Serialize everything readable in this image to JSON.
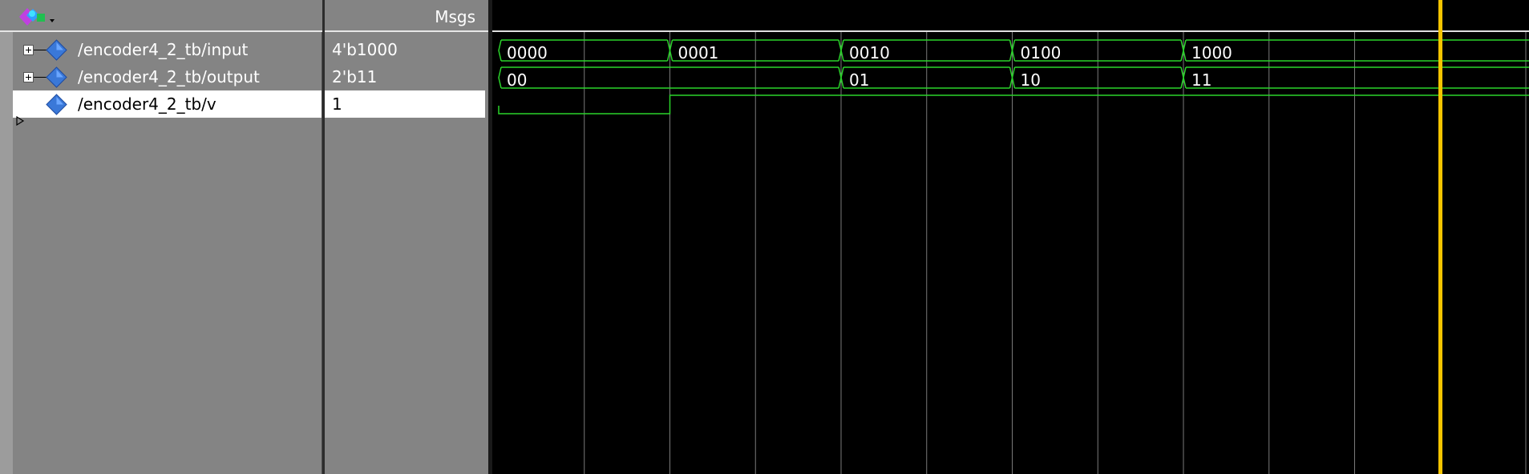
{
  "names_pane": {
    "header_menu_icon": "wave-toolbar-icon",
    "rows": [
      {
        "name": "/encoder4_2_tb/input",
        "expandable": true
      },
      {
        "name": "/encoder4_2_tb/output",
        "expandable": true
      },
      {
        "name": "/encoder4_2_tb/v",
        "expandable": false
      }
    ]
  },
  "values_pane": {
    "header": "Msgs",
    "rows": [
      "4'b1000",
      "2'b11",
      "1"
    ]
  },
  "wave_pane": {
    "input_segments": [
      "0000",
      "0001",
      "0010",
      "0100",
      "1000"
    ],
    "output_segments": [
      "00",
      "00",
      "01",
      "10",
      "11"
    ],
    "output_labels": [
      "00",
      "",
      "01",
      "10",
      "11"
    ],
    "v_levels": [
      0,
      1,
      1,
      1,
      1
    ],
    "colors": {
      "signal": "#2bd42b",
      "grid": "#7a7a7a",
      "cursor": "#f5c400",
      "background": "#000000"
    }
  }
}
